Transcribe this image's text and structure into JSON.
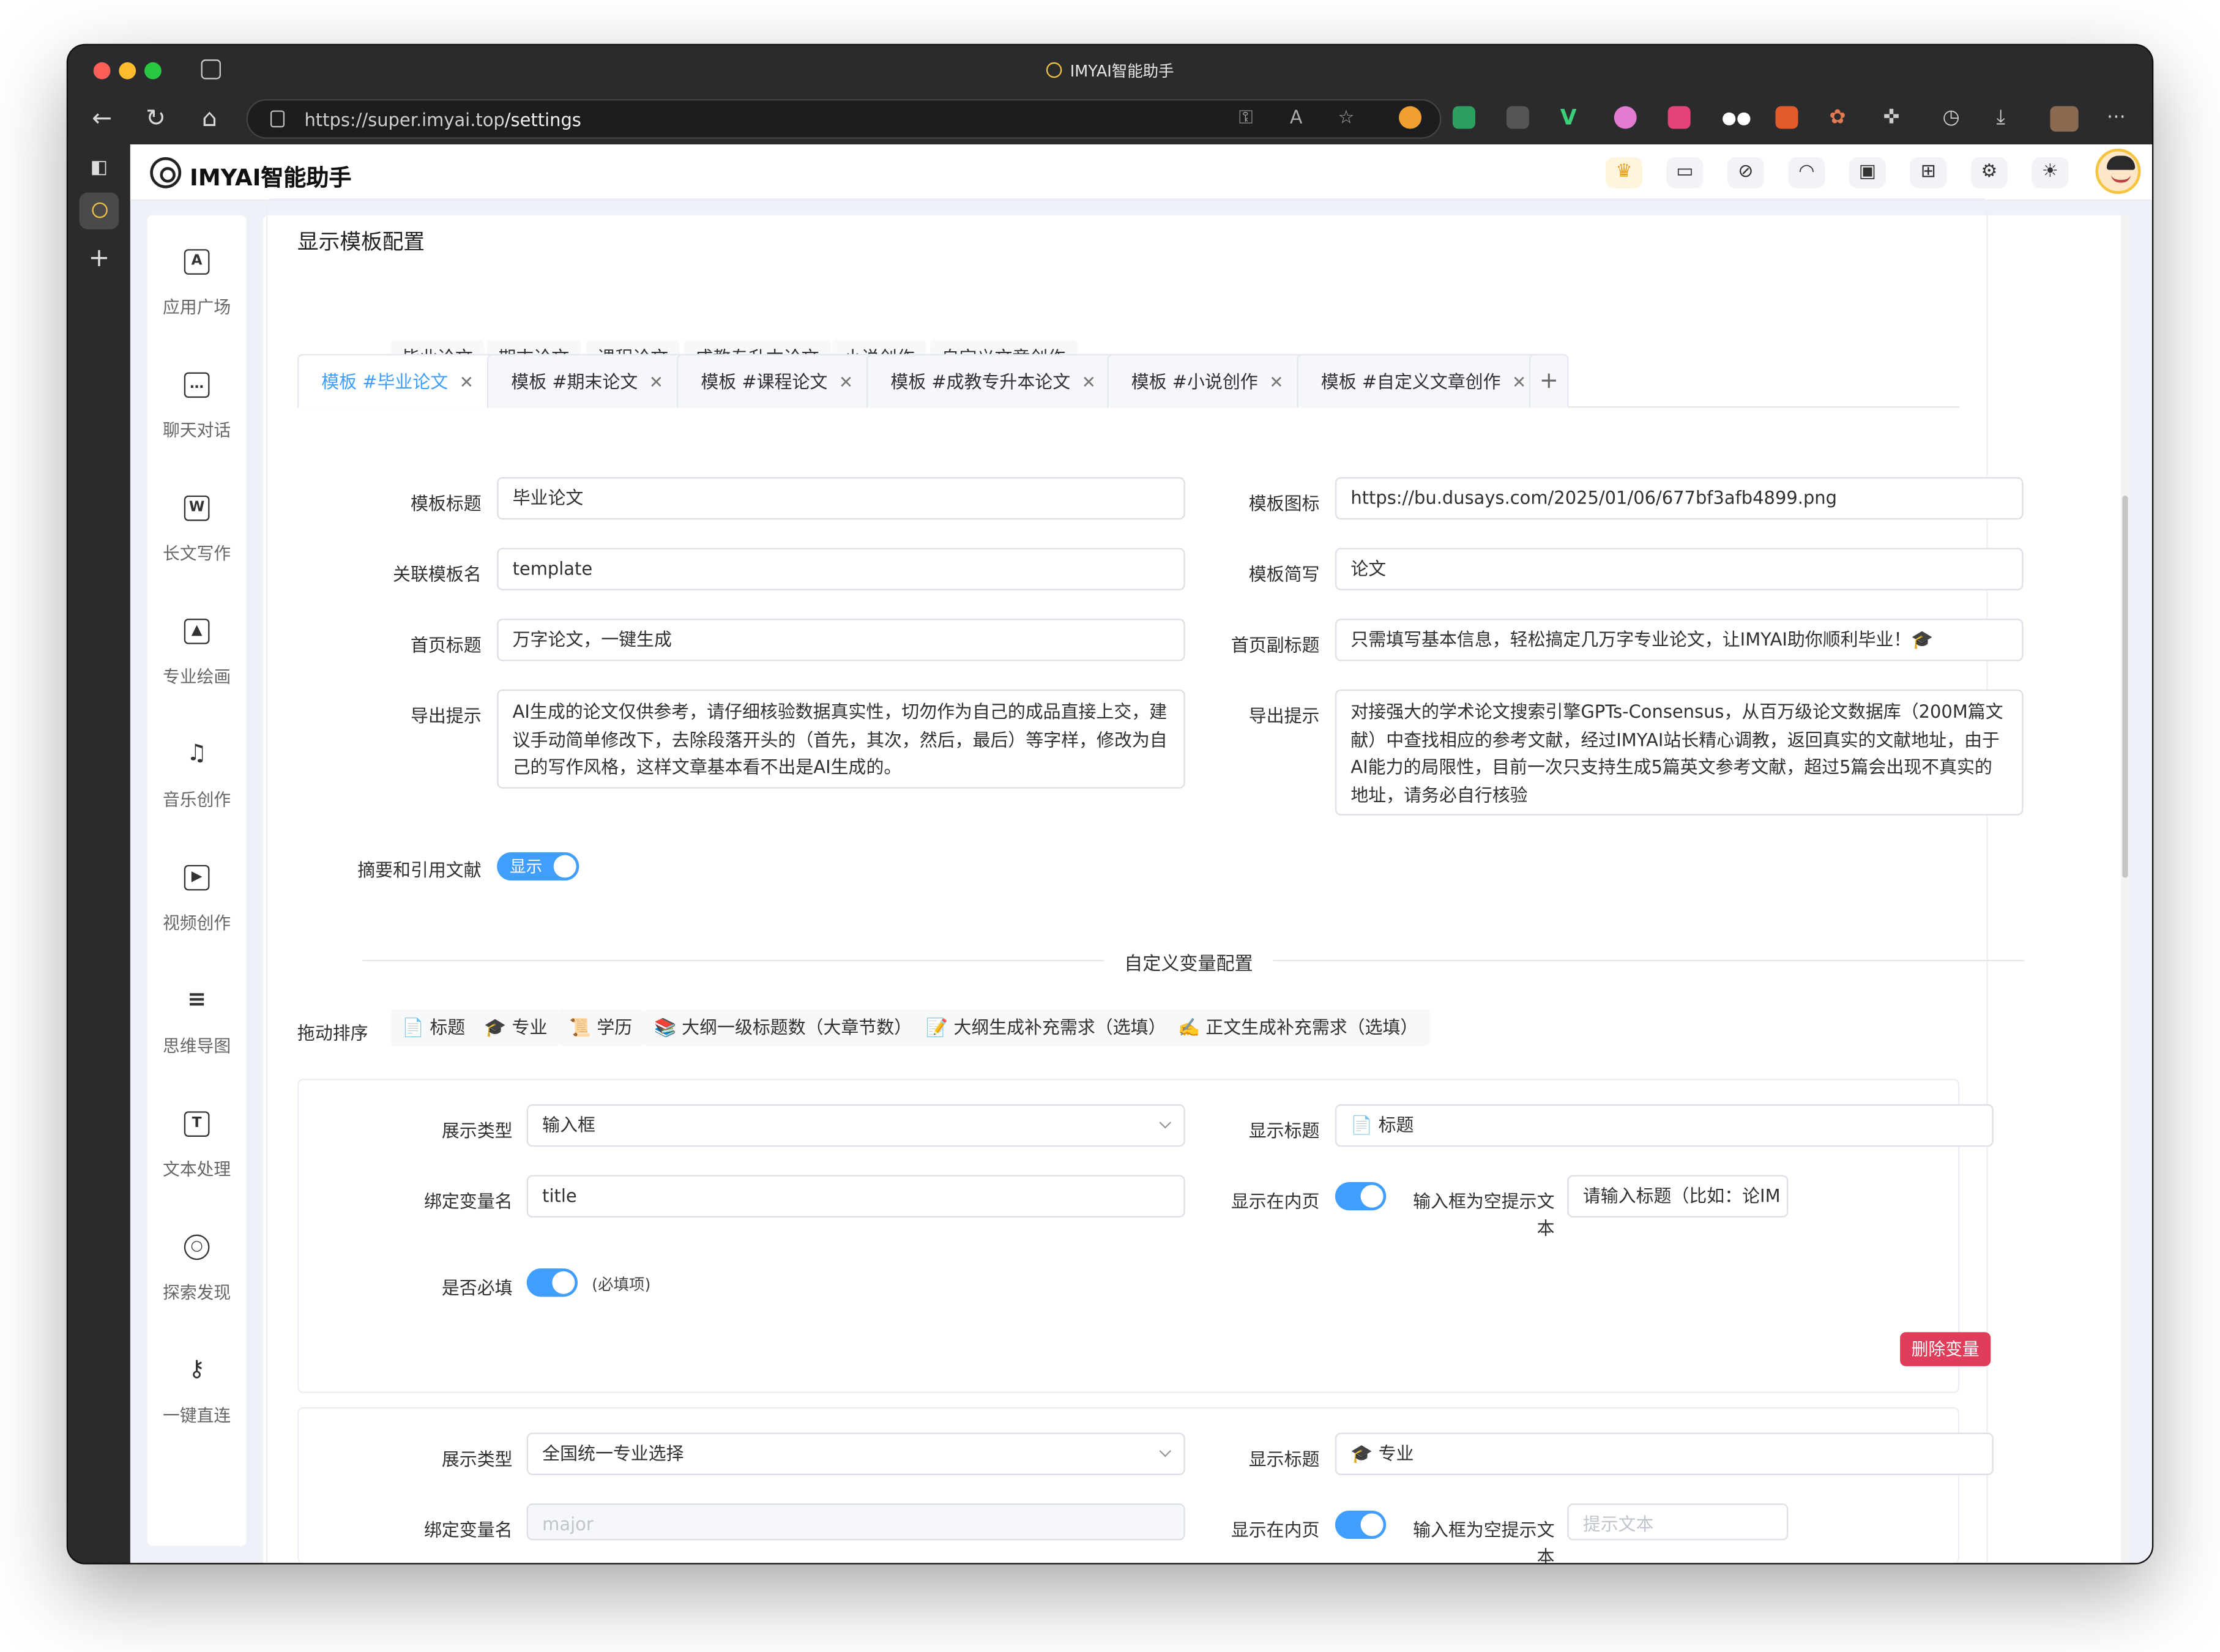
{
  "browser": {
    "window_title": "IMYAI智能助手",
    "url_host": "https://super.imyai.top",
    "url_path": "/settings"
  },
  "app": {
    "brand": "IMYAI智能助手"
  },
  "nav": [
    {
      "label": "应用广场",
      "icon": "app-grid-icon",
      "glyph": "A"
    },
    {
      "label": "聊天对话",
      "icon": "chat-icon",
      "glyph": "…"
    },
    {
      "label": "长文写作",
      "icon": "word-doc-icon",
      "glyph": "W"
    },
    {
      "label": "专业绘画",
      "icon": "image-icon",
      "glyph": "▲"
    },
    {
      "label": "音乐创作",
      "icon": "music-note-icon",
      "glyph": "♫"
    },
    {
      "label": "视频创作",
      "icon": "film-icon",
      "glyph": "▶"
    },
    {
      "label": "思维导图",
      "icon": "mindmap-icon",
      "glyph": "≡"
    },
    {
      "label": "文本处理",
      "icon": "text-icon",
      "glyph": "T"
    },
    {
      "label": "探索发现",
      "icon": "planet-icon",
      "glyph": "○"
    },
    {
      "label": "一键直连",
      "icon": "key-icon",
      "glyph": "⚷"
    }
  ],
  "section": {
    "title": "显示模板配置",
    "drag_sort_label": "拖动排序",
    "sort_items": [
      "毕业论文",
      "期末论文",
      "课程论文",
      "成教专升本论文",
      "小说创作",
      "自定义文章创作"
    ]
  },
  "template_tabs": [
    {
      "label": "模板 #毕业论文",
      "active": true
    },
    {
      "label": "模板 #期末论文",
      "active": false
    },
    {
      "label": "模板 #课程论文",
      "active": false
    },
    {
      "label": "模板 #成教专升本论文",
      "active": false
    },
    {
      "label": "模板 #小说创作",
      "active": false
    },
    {
      "label": "模板 #自定义文章创作",
      "active": false
    }
  ],
  "form": {
    "template_title_label": "模板标题",
    "template_title": "毕业论文",
    "template_icon_label": "模板图标",
    "template_icon": "https://bu.dusays.com/2025/01/06/677bf3afb4899.png",
    "linked_template_label": "关联模板名",
    "linked_template": "template",
    "template_abbr_label": "模板简写",
    "template_abbr": "论文",
    "home_title_label": "首页标题",
    "home_title": "万字论文，一键生成",
    "home_subtitle_label": "首页副标题",
    "home_subtitle": "只需填写基本信息，轻松搞定几万字专业论文，让IMYAI助你顺利毕业！🎓",
    "export_tip_label": "导出提示",
    "export_tip": "AI生成的论文仅供参考，请仔细核验数据真实性，切勿作为自己的成品直接上交，建议手动简单修改下，去除段落开头的（首先，其次，然后，最后）等字样，修改为自己的写作风格，这样文章基本看不出是AI生成的。",
    "export_tip2_label": "导出提示",
    "export_tip2": "对接强大的学术论文搜索引擎GPTs-Consensus，从百万级论文数据库（200M篇文献）中查找相应的参考文献，经过IMYAI站长精心调教，返回真实的文献地址，由于AI能力的局限性，目前一次只支持生成5篇英文参考文献，超过5篇会出现不真实的地址，请务必自行核验",
    "abstract_label": "摘要和引用文献",
    "abstract_switch": "显示"
  },
  "variables": {
    "divider_title": "自定义变量配置",
    "drag_sort_label": "拖动排序",
    "sort_items": [
      "📄 标题",
      "🎓 专业",
      "📜 学历",
      "📚 大纲一级标题数（大章节数）",
      "📝 大纲生成补充需求（选填）",
      "✍️ 正文生成补充需求（选填）"
    ],
    "cards": [
      {
        "display_type_label": "展示类型",
        "display_type": "输入框",
        "display_title_label": "显示标题",
        "display_title": "📄 标题",
        "bind_var_label": "绑定变量名",
        "bind_var": "title",
        "show_inner_label": "显示在内页",
        "placeholder_label": "输入框为空提示文本",
        "placeholder_value": "请输入标题（比如：论IM",
        "required_label": "是否必填",
        "required_note": "(必填项)",
        "delete_label": "删除变量"
      },
      {
        "display_type_label": "展示类型",
        "display_type": "全国统一专业选择",
        "display_title_label": "显示标题",
        "display_title": "🎓 专业",
        "bind_var_label": "绑定变量名",
        "bind_var_placeholder": "major",
        "show_inner_label": "显示在内页",
        "placeholder_label": "输入框为空提示文本",
        "placeholder_placeholder": "提示文本"
      }
    ]
  },
  "colors": {
    "accent": "#409eff",
    "danger": "#e03d5a",
    "page_bg": "#eef2f8"
  }
}
